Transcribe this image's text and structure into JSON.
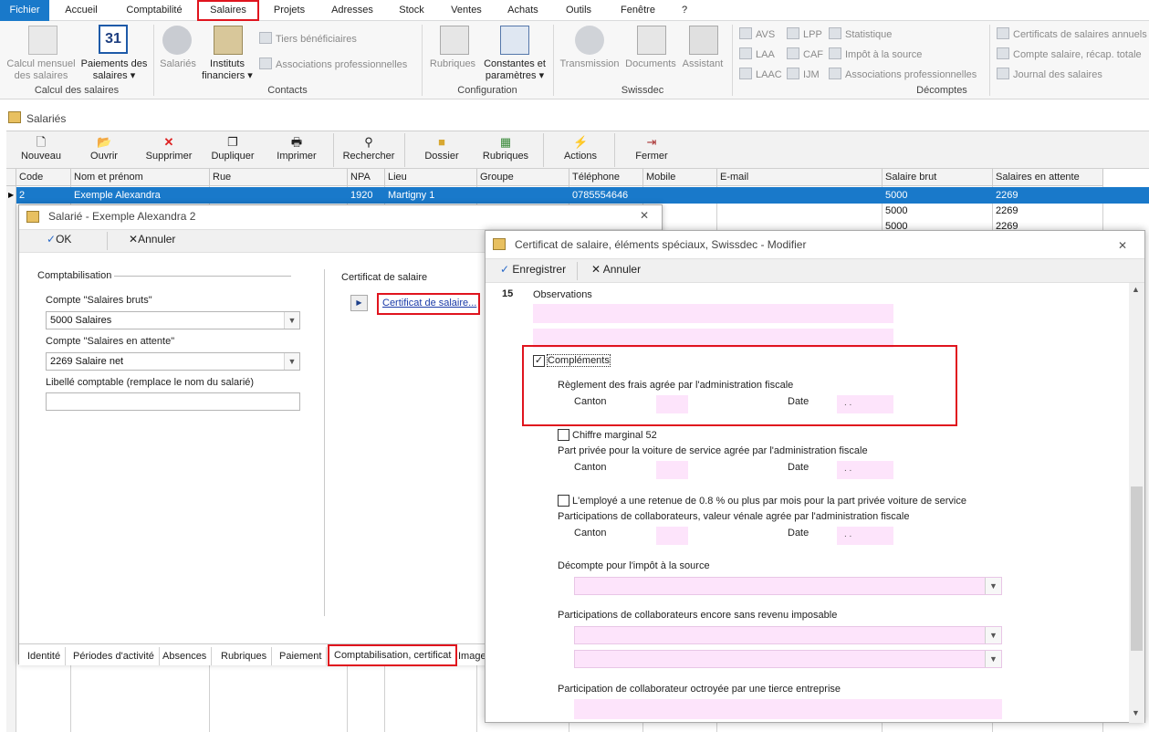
{
  "menu": {
    "items": [
      "Fichier",
      "Accueil",
      "Comptabilité",
      "Salaires",
      "Projets",
      "Adresses",
      "Stock",
      "Ventes",
      "Achats",
      "Outils",
      "Fenêtre",
      "?"
    ]
  },
  "ribbon": {
    "calcul_mensuel": "Calcul mensuel",
    "calcul_mensuel_2": "des salaires",
    "paiements": "Paiements des",
    "paiements_2": "salaires",
    "calendar_day": "31",
    "group_calcul": "Calcul des salaires",
    "salaries": "Salariés",
    "instituts": "Instituts",
    "instituts_2": "financiers",
    "tiers": "Tiers bénéficiaires",
    "associations": "Associations professionnelles",
    "group_contacts": "Contacts",
    "rubriques": "Rubriques",
    "constantes": "Constantes et",
    "constantes_2": "paramètres",
    "group_config": "Configuration",
    "transmission": "Transmission",
    "documents": "Documents",
    "assistant": "Assistant",
    "group_swissdec": "Swissdec",
    "avs": "AVS",
    "laa": "LAA",
    "laac": "LAAC",
    "lpp": "LPP",
    "caf": "CAF",
    "ijm": "IJM",
    "statistique": "Statistique",
    "impot": "Impôt à la source",
    "assoc_prof": "Associations professionnelles",
    "cert_annuels": "Certificats de salaires annuels",
    "compte_salaire": "Compte salaire, récap. totale",
    "journal": "Journal des salaires",
    "group_decomptes": "Décomptes"
  },
  "salaries_title": "Salariés",
  "toolbar": {
    "nouveau": "Nouveau",
    "ouvrir": "Ouvrir",
    "supprimer": "Supprimer",
    "dupliquer": "Dupliquer",
    "imprimer": "Imprimer",
    "rechercher": "Rechercher",
    "dossier": "Dossier",
    "rubriques": "Rubriques",
    "actions": "Actions",
    "fermer": "Fermer"
  },
  "grid": {
    "headers": [
      "Code",
      "Nom et prénom",
      "Rue",
      "NPA",
      "Lieu",
      "Groupe",
      "Téléphone",
      "Mobile",
      "E-mail",
      "Salaire brut",
      "Salaires en attente"
    ],
    "selected_row": {
      "code": "2",
      "nom": "Exemple Alexandra",
      "npa": "1920",
      "lieu": "Martigny 1",
      "tel": "0785554646",
      "brut": "5000",
      "attente": "2269"
    },
    "row2": {
      "brut": "5000",
      "attente": "2269"
    },
    "row3": {
      "brut": "5000",
      "attente": "2269"
    }
  },
  "dialog1": {
    "title": "Salarié - Exemple Alexandra 2",
    "ok": "OK",
    "annuler": "Annuler",
    "comptabilisation": "Comptabilisation",
    "compte_bruts_label": "Compte \"Salaires bruts\"",
    "compte_bruts_value": "5000 Salaires",
    "compte_attente_label": "Compte \"Salaires en attente\"",
    "compte_attente_value": "2269 Salaire net",
    "libelle_label": "Libellé comptable (remplace le nom du salarié)",
    "certificat_section": "Certificat de salaire",
    "certificat_link": "Certificat de salaire...",
    "tabs": [
      "Identité",
      "Périodes d'activité",
      "Absences",
      "Rubriques",
      "Paiement",
      "Comptabilisation, certificat",
      "Image"
    ]
  },
  "dialog2": {
    "title": "Certificat de salaire, éléments spéciaux, Swissdec - Modifier",
    "enregistrer": "Enregistrer",
    "annuler": "Annuler",
    "num15": "15",
    "observations": "Observations",
    "complements": "Compléments",
    "reglement": "Règlement des frais agrée par l'administration fiscale",
    "canton": "Canton",
    "date": "Date",
    "date_placeholder": ". .",
    "chiffre": "Chiffre marginal 52",
    "part_privee": "Part privée pour la voiture de service agrée par l'administration fiscale",
    "employe": "L'employé a une retenue de 0.8 % ou plus par mois pour la part privée voiture de service",
    "participations": "Participations de collaborateurs, valeur vénale agrée par l'administration fiscale",
    "decompte": "Décompte pour l'impôt à la source",
    "participations_sans": "Participations de collaborateurs encore sans revenu imposable",
    "participation_tierce": "Participation de collaborateur octroyée par une tierce entreprise"
  }
}
